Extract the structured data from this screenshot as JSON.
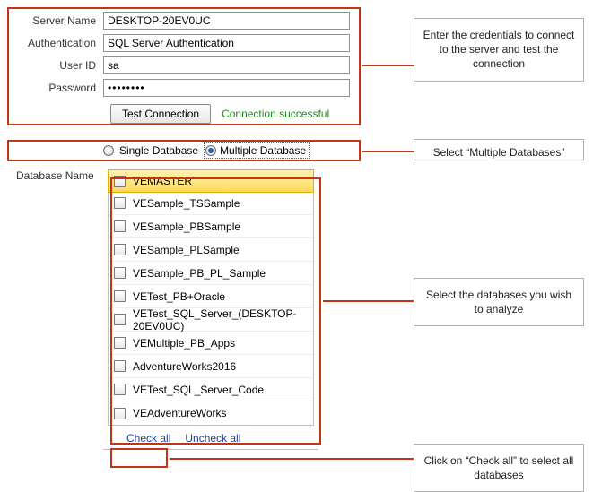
{
  "credentials": {
    "server_name_label": "Server Name",
    "server_name_value": "DESKTOP-20EV0UC",
    "auth_label": "Authentication",
    "auth_value": "SQL Server Authentication",
    "user_label": "User ID",
    "user_value": "sa",
    "password_label": "Password",
    "password_value": "••••••••",
    "test_btn": "Test Connection",
    "status": "Connection successful"
  },
  "mode": {
    "single_label": "Single Database",
    "multiple_label": "Multiple Database"
  },
  "db_section_label": "Database Name",
  "databases": [
    "VEMASTER",
    "VESample_TSSample",
    "VESample_PBSample",
    "VESample_PLSample",
    "VESample_PB_PL_Sample",
    "VETest_PB+Oracle",
    "VETest_SQL_Server_(DESKTOP-20EV0UC)",
    "VEMultiple_PB_Apps",
    "AdventureWorks2016",
    "VETest_SQL_Server_Code",
    "VEAdventureWorks"
  ],
  "actions": {
    "check_all": "Check all",
    "uncheck_all": "Uncheck all"
  },
  "annotations": {
    "a1": "Enter the credentials to connect to the server and test the connection",
    "a2": "Select “Multiple Databases”",
    "a3": "Select the databases you wish to analyze",
    "a4": "Click on “Check all” to select all databases"
  }
}
